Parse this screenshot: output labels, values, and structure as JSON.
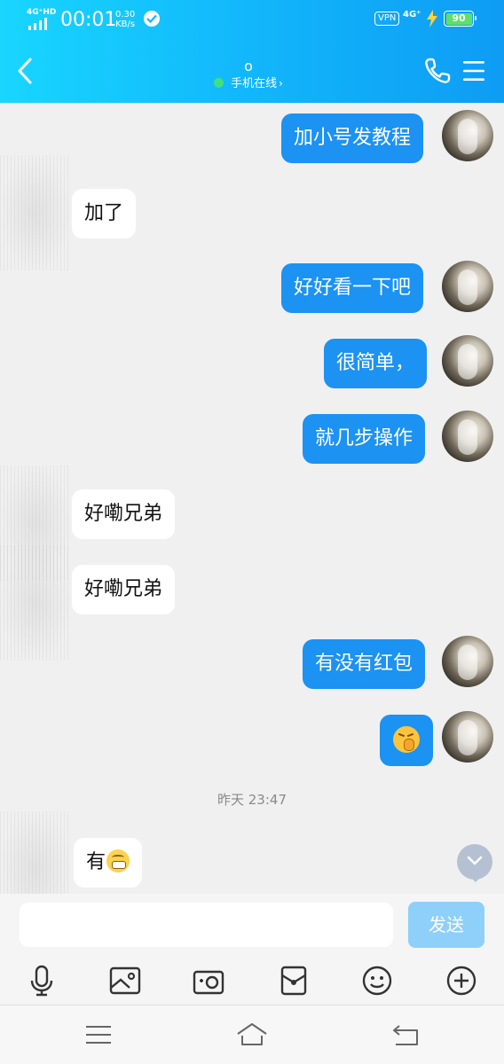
{
  "status_bar": {
    "network": "4G⁺HD",
    "time": "00:01",
    "speed_value": "0.30",
    "speed_unit": "KB/s",
    "vpn": "VPN",
    "net_type": "4G⁺",
    "battery": "90"
  },
  "header": {
    "name": "o",
    "online_status": "手机在线",
    "online_arrow": "›"
  },
  "messages": [
    {
      "side": "out",
      "text": "加小号发教程"
    },
    {
      "side": "in",
      "text": "加了"
    },
    {
      "side": "out",
      "text": "好好看一下吧"
    },
    {
      "side": "out",
      "text": "很简单，"
    },
    {
      "side": "out",
      "text": "就几步操作"
    },
    {
      "side": "in",
      "text": "好嘞兄弟"
    },
    {
      "side": "in",
      "text": "好嘞兄弟"
    },
    {
      "side": "out",
      "text": "有没有红包"
    },
    {
      "side": "out",
      "emoji": "shy-hand-face-emoji"
    },
    {
      "side": "in",
      "text": "有",
      "emoji": "grin-emoji"
    }
  ],
  "timestamp": "昨天 23:47",
  "composer": {
    "placeholder": "",
    "value": "",
    "send_label": "发送"
  },
  "toolbar_icons": [
    "microphone-icon",
    "image-icon",
    "camera-icon",
    "red-packet-icon",
    "emoji-icon",
    "plus-icon"
  ],
  "nav_icons": [
    "menu-icon",
    "home-icon",
    "back-icon"
  ],
  "colors": {
    "header_start": "#18d6ff",
    "header_end": "#0e9cf4",
    "outgoing_bubble": "#1c92f3",
    "incoming_bubble": "#ffffff",
    "send_button": "#8fd0fb",
    "online_dot": "#41e07f"
  }
}
